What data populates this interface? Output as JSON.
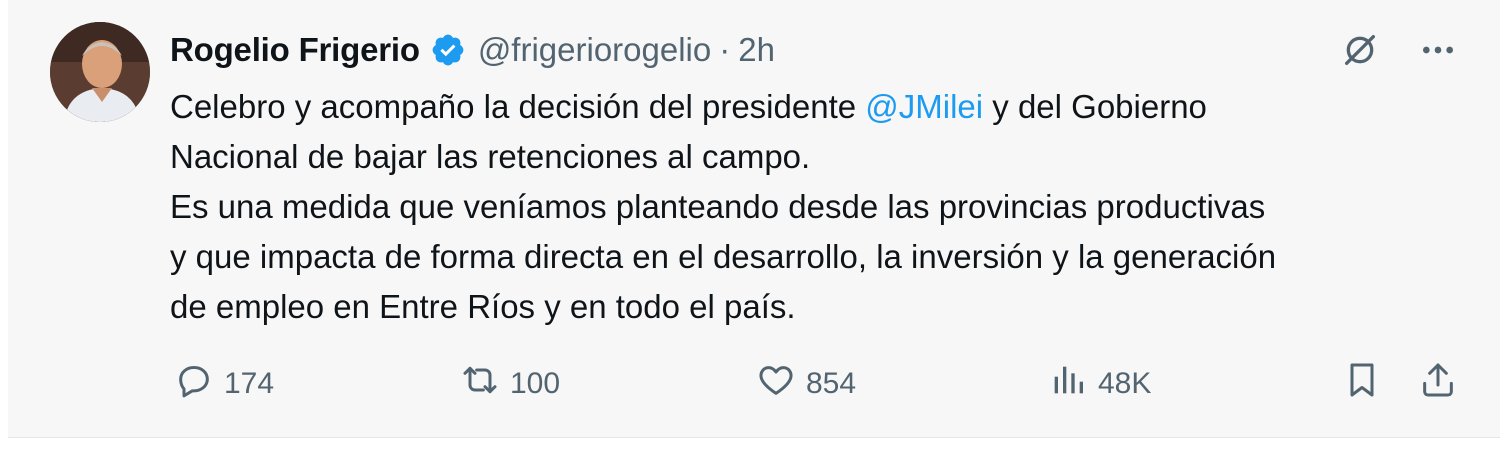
{
  "tweet": {
    "author_name": "Rogelio Frigerio",
    "handle": "@frigeriorogelio",
    "separator": "·",
    "time": "2h",
    "text_parts": {
      "p1": "Celebro y acompaño la decisión del presidente ",
      "mention": "@JMilei",
      "p2": " y del Gobierno",
      "line2": "Nacional de bajar las retenciones al campo.",
      "line3": "Es una medida que veníamos planteando desde las provincias productivas",
      "line4": "y que impacta de forma directa en el desarrollo, la inversión y la generación",
      "line5": "de empleo en Entre Ríos y en todo el país."
    },
    "icons": {
      "verified": "verified-badge-icon",
      "grok": "grok-icon",
      "more": "more-icon"
    }
  },
  "actions": {
    "replies": "174",
    "retweets": "100",
    "likes": "854",
    "views": "48K"
  },
  "colors": {
    "accent": "#1d9bf0",
    "muted": "#536471",
    "text": "#0f1419",
    "background": "#f7f7f7"
  }
}
